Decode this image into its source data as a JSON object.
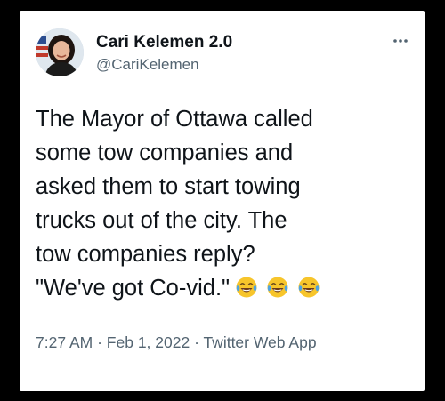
{
  "tweet": {
    "author": {
      "display_name": "Cari Kelemen 2.0",
      "handle": "@CariKelemen"
    },
    "text_lines": [
      "The Mayor of Ottawa called",
      "some tow companies and",
      "asked them to start towing",
      "trucks out of the city. The",
      "tow companies reply?",
      "\"We've got Co-vid.\""
    ],
    "emojis": [
      "tears-of-joy-emoji",
      "tears-of-joy-emoji",
      "tears-of-joy-emoji"
    ],
    "time": "7:27 AM",
    "separator": "·",
    "date": "Feb 1, 2022",
    "client": "Twitter Web App"
  },
  "colors": {
    "background": "#000000",
    "card": "#ffffff",
    "text": "#0f1419",
    "secondary_text": "#536471",
    "emoji_face": "#f7c52b",
    "emoji_tear": "#4fa3e0"
  },
  "icons": {
    "more": "more-horizontal-icon"
  }
}
